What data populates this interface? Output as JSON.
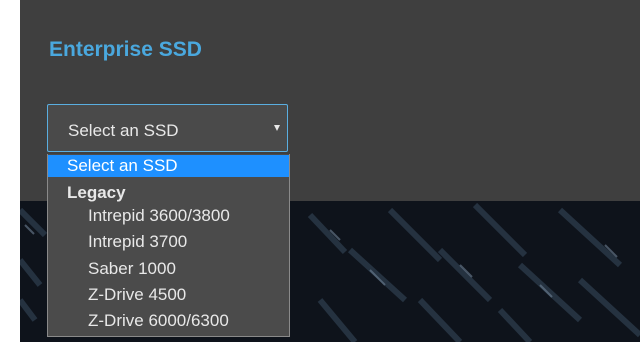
{
  "page": {
    "title": "Enterprise SSD"
  },
  "select": {
    "value": "Select an SSD"
  },
  "dropdown": {
    "selected_option": "Select an SSD",
    "group_label": "Legacy",
    "options": [
      "Intrepid 3600/3800",
      "Intrepid 3700",
      "Saber 1000",
      "Z-Drive 4500",
      "Z-Drive 6000/6300"
    ]
  },
  "colors": {
    "title": "#4aa8de",
    "panel": "#3f3f3f",
    "highlight": "#1e90ff",
    "select_border": "#5aaee0"
  }
}
